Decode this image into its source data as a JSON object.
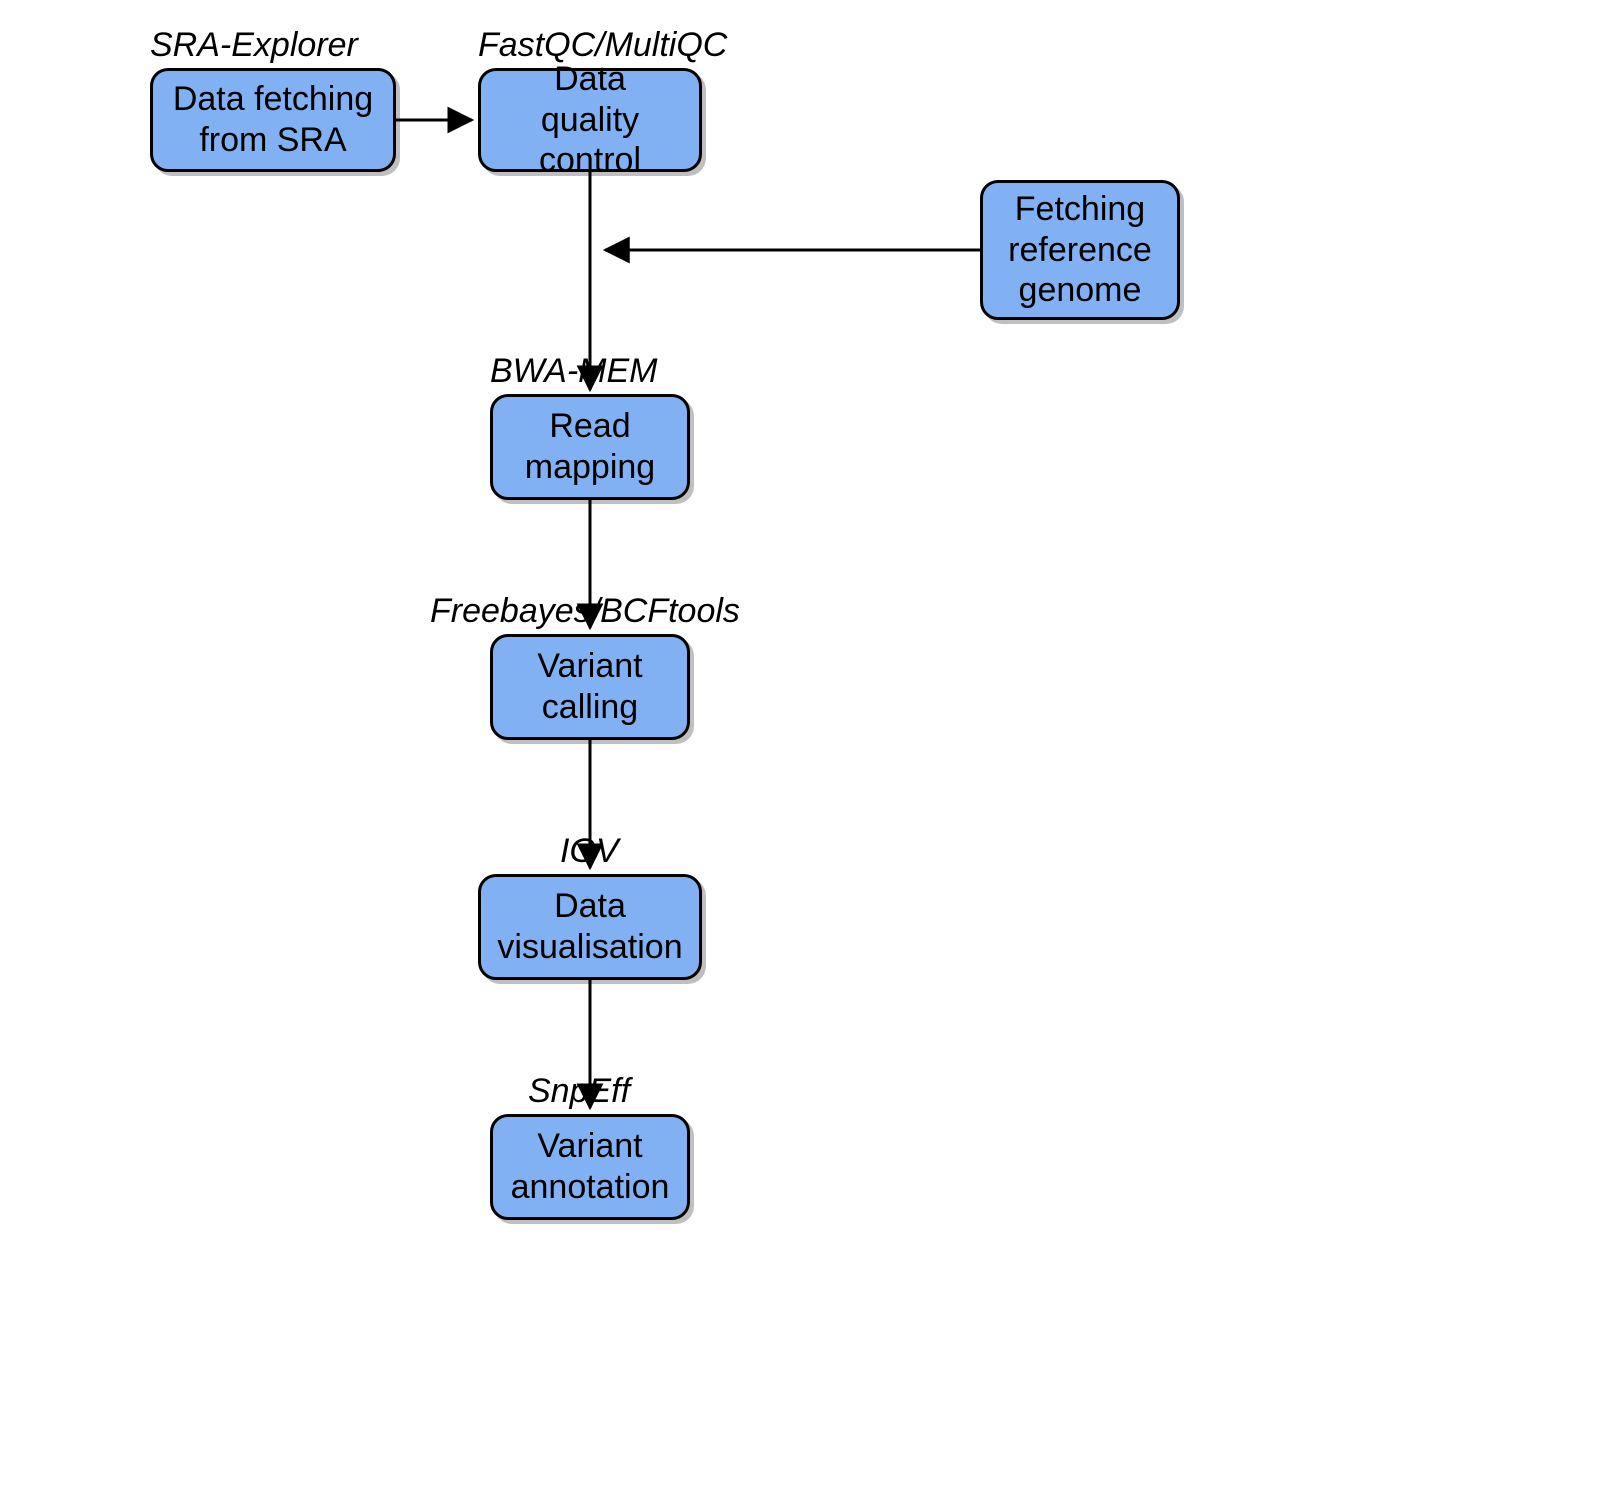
{
  "nodes": {
    "sra_fetch": {
      "label": "Data fetching\nfrom SRA",
      "tool": "SRA-Explorer"
    },
    "qc": {
      "label": "Data\nquality control",
      "tool": "FastQC/MultiQC"
    },
    "ref_genome": {
      "label": "Fetching\nreference\ngenome",
      "tool": ""
    },
    "read_mapping": {
      "label": "Read\nmapping",
      "tool": "BWA-MEM"
    },
    "variant_calling": {
      "label": "Variant\ncalling",
      "tool": "Freebayes/BCFtools"
    },
    "data_vis": {
      "label": "Data\nvisualisation",
      "tool": "IGV"
    },
    "variant_annot": {
      "label": "Variant\nannotation",
      "tool": "SnpEff"
    }
  },
  "edges": [
    {
      "from": "sra_fetch",
      "to": "qc"
    },
    {
      "from": "qc",
      "to": "read_mapping"
    },
    {
      "from": "ref_genome",
      "to": "read_mapping",
      "merge_into": "qc->read_mapping"
    },
    {
      "from": "read_mapping",
      "to": "variant_calling"
    },
    {
      "from": "variant_calling",
      "to": "data_vis"
    },
    {
      "from": "data_vis",
      "to": "variant_annot"
    }
  ],
  "colors": {
    "node_fill": "#81b1f2",
    "node_border": "#000000",
    "bg": "#ffffff"
  }
}
